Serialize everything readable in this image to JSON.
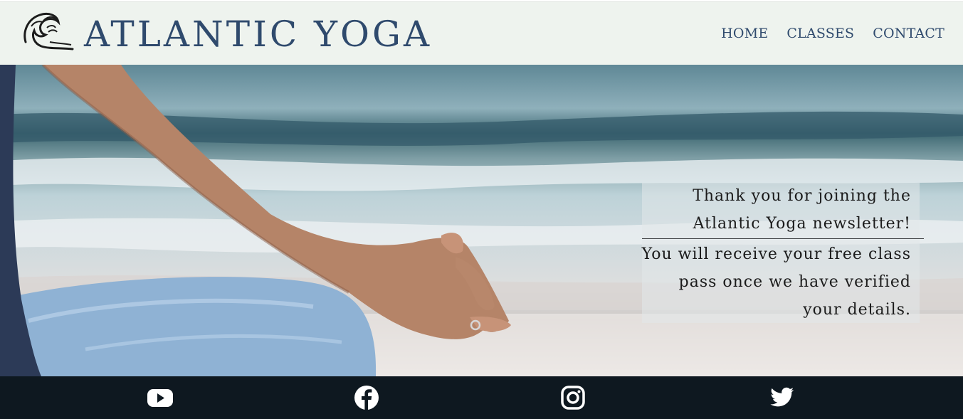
{
  "header": {
    "brand": "ATLANTIC YOGA",
    "logo_icon": "wave-icon",
    "nav": [
      {
        "label": "HOME"
      },
      {
        "label": "CLASSES"
      },
      {
        "label": "CONTACT"
      }
    ]
  },
  "message": {
    "lines": [
      "Thank you for joining the",
      "Atlantic Yoga newsletter!",
      "You will receive your free class",
      "pass once we have verified",
      "your details."
    ]
  },
  "footer": {
    "social": [
      {
        "icon": "youtube-icon"
      },
      {
        "icon": "facebook-icon"
      },
      {
        "icon": "instagram-icon"
      },
      {
        "icon": "twitter-icon"
      }
    ]
  },
  "colors": {
    "brand": "#2f4a6d",
    "header_bg": "#eef3ee",
    "footer_bg": "#0e1820"
  }
}
